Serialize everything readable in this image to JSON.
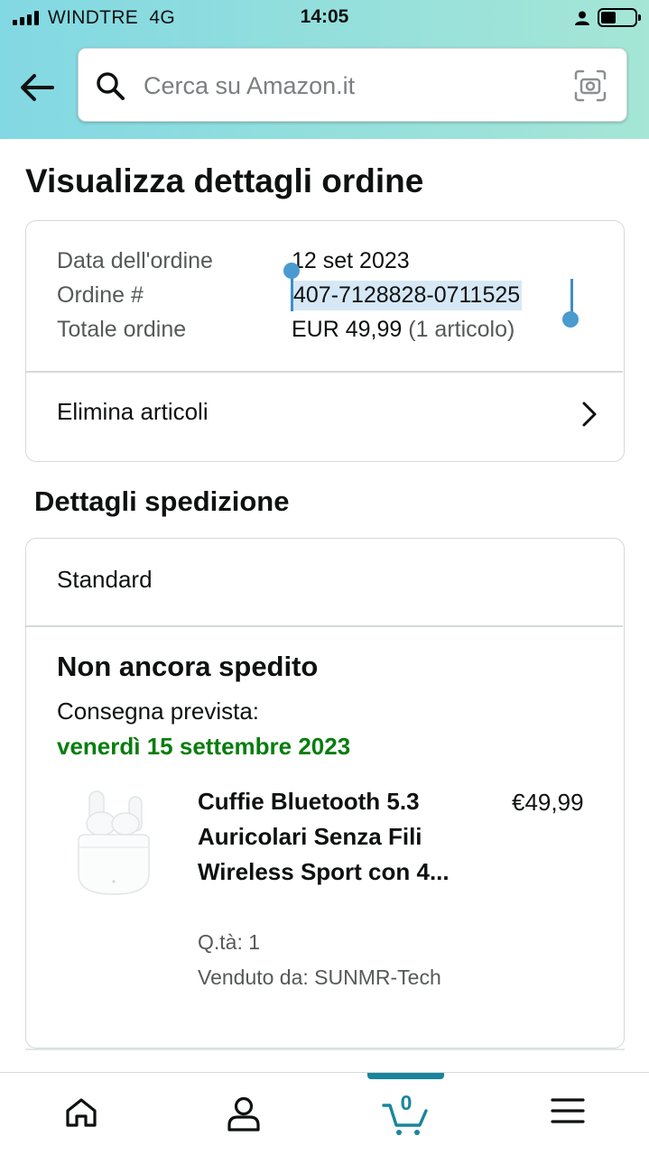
{
  "status_bar": {
    "carrier": "WINDTRE",
    "network": "4G",
    "time": "14:05"
  },
  "search": {
    "placeholder": "Cerca su Amazon.it"
  },
  "page_title": "Visualizza dettagli ordine",
  "order_summary": {
    "date_label": "Data dell'ordine",
    "date_value": "12 set 2023",
    "order_label": "Ordine #",
    "order_value": "407-7128828-0711525",
    "total_label": "Totale ordine",
    "total_value": "EUR 49,99",
    "total_items": "(1 articolo)",
    "delete_items_label": "Elimina articoli"
  },
  "shipping": {
    "section_title": "Dettagli spedizione",
    "method": "Standard",
    "status": "Non ancora spedito",
    "delivery_label": "Consegna prevista:",
    "delivery_date": "venerdì 15 settembre 2023",
    "product": {
      "name": "Cuffie Bluetooth 5.3 Auricolari Senza Fili Wireless Sport con 4...",
      "price": "€49,99",
      "quantity": "Q.tà: 1",
      "seller": "Venduto da: SUNMR-Tech"
    }
  },
  "bottom_nav": {
    "cart_count": "0",
    "items": [
      "home-icon",
      "account-icon",
      "cart-icon",
      "menu-icon"
    ]
  },
  "colors": {
    "header_gradient_start": "#82d8e3",
    "header_gradient_end": "#a5e6d6",
    "delivery_green": "#067d0d",
    "cart_accent": "#19859b",
    "selection_blue": "#4a9bcf"
  }
}
